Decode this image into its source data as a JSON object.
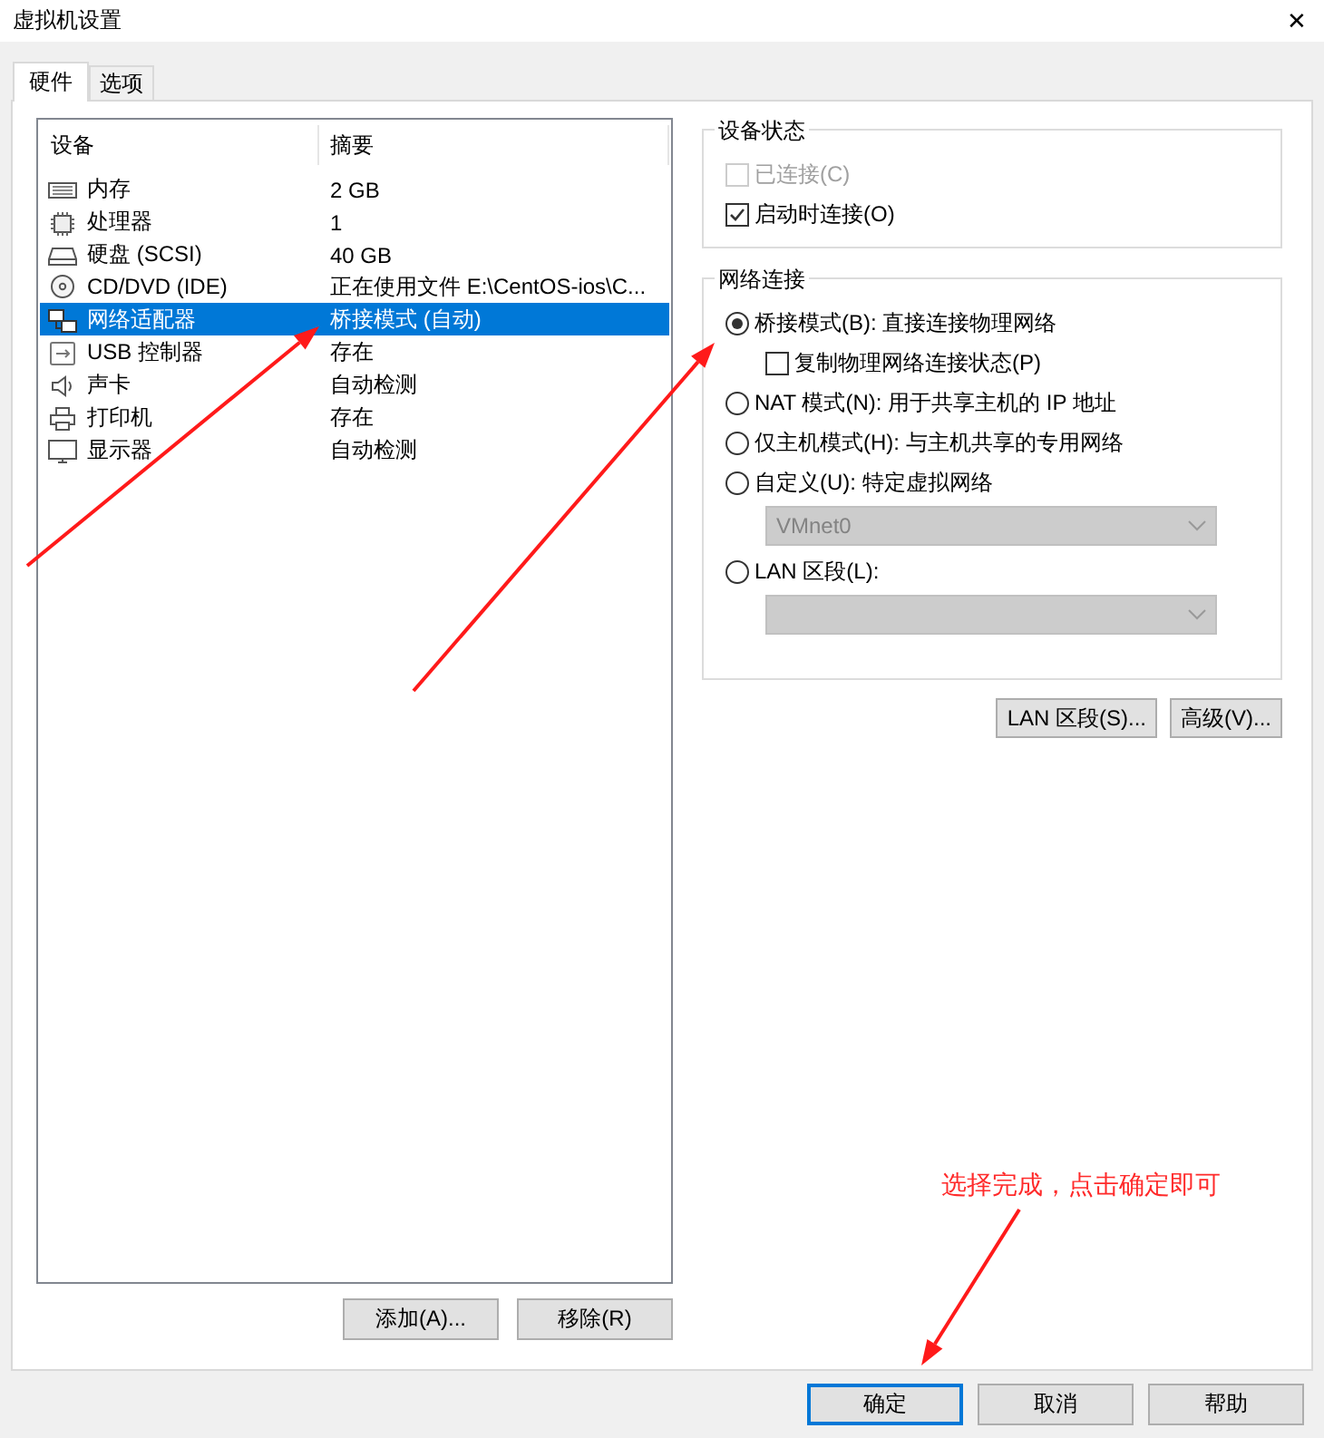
{
  "window": {
    "title": "虚拟机设置",
    "close": "✕"
  },
  "tabs": [
    {
      "label": "硬件",
      "selected": true
    },
    {
      "label": "选项",
      "selected": false
    }
  ],
  "device_table": {
    "columns": [
      "设备",
      "摘要"
    ],
    "rows": [
      {
        "kind": "memory",
        "device": "内存",
        "summary": "2 GB",
        "selected": false
      },
      {
        "kind": "cpu",
        "device": "处理器",
        "summary": "1",
        "selected": false
      },
      {
        "kind": "disk",
        "device": "硬盘 (SCSI)",
        "summary": "40 GB",
        "selected": false
      },
      {
        "kind": "cd",
        "device": "CD/DVD (IDE)",
        "summary": "正在使用文件 E:\\CentOS-ios\\C...",
        "selected": false
      },
      {
        "kind": "network",
        "device": "网络适配器",
        "summary": "桥接模式 (自动)",
        "selected": true
      },
      {
        "kind": "usb",
        "device": "USB 控制器",
        "summary": "存在",
        "selected": false
      },
      {
        "kind": "sound",
        "device": "声卡",
        "summary": "自动检测",
        "selected": false
      },
      {
        "kind": "printer",
        "device": "打印机",
        "summary": "存在",
        "selected": false
      },
      {
        "kind": "monitor",
        "device": "显示器",
        "summary": "自动检测",
        "selected": false
      }
    ]
  },
  "device_buttons": [
    "添加(A)...",
    "移除(R)"
  ],
  "device_status": {
    "title": "设备状态",
    "options": [
      {
        "label": "已连接(C)",
        "checked": false,
        "disabled": true
      },
      {
        "label": "启动时连接(O)",
        "checked": true,
        "disabled": false
      }
    ]
  },
  "network_connection": {
    "title": "网络连接",
    "items": [
      {
        "kind": "radio",
        "label": "桥接模式(B): 直接连接物理网络",
        "selected": true
      },
      {
        "kind": "checkbox",
        "label": "复制物理网络连接状态(P)",
        "checked": false
      },
      {
        "kind": "radio",
        "label": "NAT 模式(N): 用于共享主机的 IP 地址",
        "selected": false
      },
      {
        "kind": "radio",
        "label": "仅主机模式(H): 与主机共享的专用网络",
        "selected": false
      },
      {
        "kind": "radio",
        "label": "自定义(U): 特定虚拟网络",
        "selected": false
      },
      {
        "kind": "dropdown",
        "value": "VMnet0",
        "disabled": true
      },
      {
        "kind": "radio",
        "label": "LAN 区段(L):",
        "selected": false
      },
      {
        "kind": "dropdown",
        "disabled": true
      }
    ]
  },
  "network_buttons": [
    "LAN 区段(S)...",
    "高级(V)..."
  ],
  "dialog_buttons": [
    {
      "label": "确定",
      "default": true
    },
    {
      "label": "取消",
      "default": false
    },
    {
      "label": "帮助",
      "default": false
    }
  ],
  "annotation": {
    "text": "选择完成，点击确定即可"
  }
}
